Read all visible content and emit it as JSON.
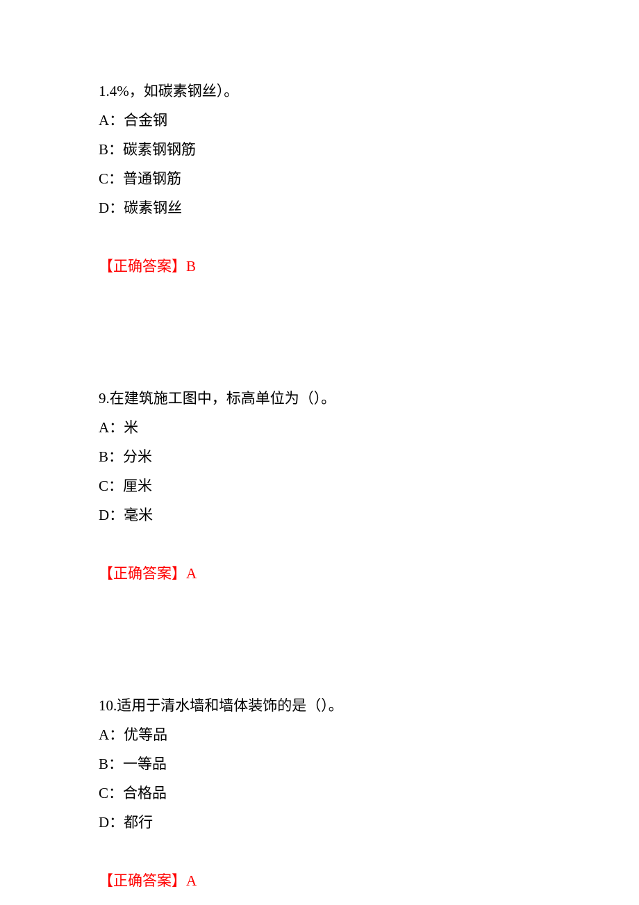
{
  "questions": [
    {
      "stem": "1.4%，如碳素钢丝）。",
      "options": {
        "A": "A：合金钢",
        "B": "B：碳素钢钢筋",
        "C": "C：普通钢筋",
        "D": "D：碳素钢丝"
      },
      "answer_label": "【正确答案】",
      "answer_value": "B"
    },
    {
      "stem": "9.在建筑施工图中，标高单位为（）。",
      "options": {
        "A": "A：米",
        "B": "B：分米",
        "C": "C：厘米",
        "D": "D：毫米"
      },
      "answer_label": "【正确答案】",
      "answer_value": "A"
    },
    {
      "stem": "10.适用于清水墙和墙体装饰的是（）。",
      "options": {
        "A": "A：优等品",
        "B": "B：一等品",
        "C": "C：合格品",
        "D": "D：都行"
      },
      "answer_label": "【正确答案】",
      "answer_value": "A"
    }
  ]
}
